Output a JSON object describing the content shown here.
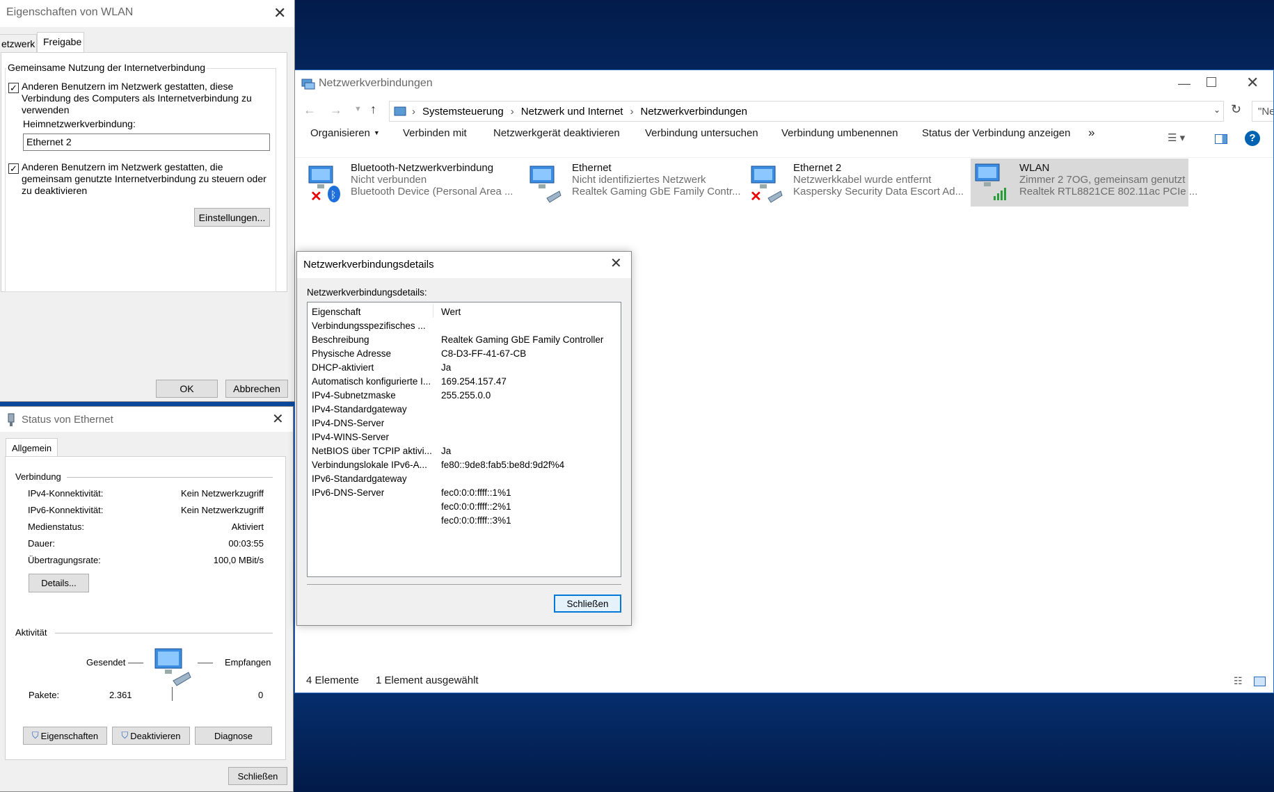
{
  "wlan_props": {
    "title": "Eigenschaften von WLAN",
    "tabs": [
      "etzwerk",
      "Freigabe"
    ],
    "group": "Gemeinsame Nutzung der Internetverbindung",
    "cb1": "Anderen Benutzern im Netzwerk gestatten, diese Verbindung des Computers als Internetverbindung zu verwenden",
    "home_label": "Heimnetzwerkverbindung:",
    "home_value": "Ethernet 2",
    "cb2": "Anderen Benutzern im Netzwerk gestatten, die gemeinsam genutzte Internetverbindung zu steuern oder zu deaktivieren",
    "settings": "Einstellungen...",
    "ok": "OK",
    "cancel": "Abbrechen"
  },
  "eth_status": {
    "title": "Status von Ethernet",
    "tab": "Allgemein",
    "conn_group": "Verbindung",
    "rows": [
      {
        "label": "IPv4-Konnektivität:",
        "value": "Kein Netzwerkzugriff"
      },
      {
        "label": "IPv6-Konnektivität:",
        "value": "Kein Netzwerkzugriff"
      },
      {
        "label": "Medienstatus:",
        "value": "Aktiviert"
      },
      {
        "label": "Dauer:",
        "value": "00:03:55"
      },
      {
        "label": "Übertragungsrate:",
        "value": "100,0 MBit/s"
      }
    ],
    "details": "Details...",
    "activity_group": "Aktivität",
    "sent": "Gesendet",
    "received": "Empfangen",
    "packets_label": "Pakete:",
    "packets_sent": "2.361",
    "packets_recv": "0",
    "btn_props": "Eigenschaften",
    "btn_disable": "Deaktivieren",
    "btn_diag": "Diagnose",
    "close": "Schließen"
  },
  "explorer": {
    "title": "Netzwerkverbindungen",
    "breadcrumb": [
      "Systemsteuerung",
      "Netzwerk und Internet",
      "Netzwerkverbindungen"
    ],
    "search": "\"Netzwerkverbindung...",
    "toolbar": [
      "Organisieren",
      "Verbinden mit",
      "Netzwerkgerät deaktivieren",
      "Verbindung untersuchen",
      "Verbindung umbenennen",
      "Status der Verbindung anzeigen"
    ],
    "more": "»",
    "items": [
      {
        "name": "Bluetooth-Netzwerkverbindung",
        "status": "Nicht verbunden",
        "device": "Bluetooth Device (Personal Area ..."
      },
      {
        "name": "Ethernet",
        "status": "Nicht identifiziertes Netzwerk",
        "device": "Realtek Gaming GbE Family Contr..."
      },
      {
        "name": "Ethernet 2",
        "status": "Netzwerkkabel wurde entfernt",
        "device": "Kaspersky Security Data Escort Ad..."
      },
      {
        "name": "WLAN",
        "status": "Zimmer 2 7OG, gemeinsam genutzt",
        "device": "Realtek RTL8821CE 802.11ac PCIe ..."
      }
    ],
    "count": "4 Elemente",
    "selected": "1 Element ausgewählt",
    "accent": "#0078d7"
  },
  "details": {
    "title": "Netzwerkverbindungsdetails",
    "label": "Netzwerkverbindungsdetails:",
    "col_prop": "Eigenschaft",
    "col_val": "Wert",
    "rows": [
      {
        "p": "Verbindungsspezifisches ...",
        "v": ""
      },
      {
        "p": "Beschreibung",
        "v": "Realtek Gaming GbE Family Controller"
      },
      {
        "p": "Physische Adresse",
        "v": "C8-D3-FF-41-67-CB"
      },
      {
        "p": "DHCP-aktiviert",
        "v": "Ja"
      },
      {
        "p": "Automatisch konfigurierte I...",
        "v": "169.254.157.47"
      },
      {
        "p": "IPv4-Subnetzmaske",
        "v": "255.255.0.0"
      },
      {
        "p": "IPv4-Standardgateway",
        "v": ""
      },
      {
        "p": "IPv4-DNS-Server",
        "v": ""
      },
      {
        "p": "IPv4-WINS-Server",
        "v": ""
      },
      {
        "p": "NetBIOS über TCPIP aktivi...",
        "v": "Ja"
      },
      {
        "p": "Verbindungslokale IPv6-A...",
        "v": "fe80::9de8:fab5:be8d:9d2f%4"
      },
      {
        "p": "IPv6-Standardgateway",
        "v": ""
      },
      {
        "p": "IPv6-DNS-Server",
        "v": "fec0:0:0:ffff::1%1"
      },
      {
        "p": "",
        "v": "fec0:0:0:ffff::2%1"
      },
      {
        "p": "",
        "v": "fec0:0:0:ffff::3%1"
      }
    ],
    "close": "Schließen"
  }
}
